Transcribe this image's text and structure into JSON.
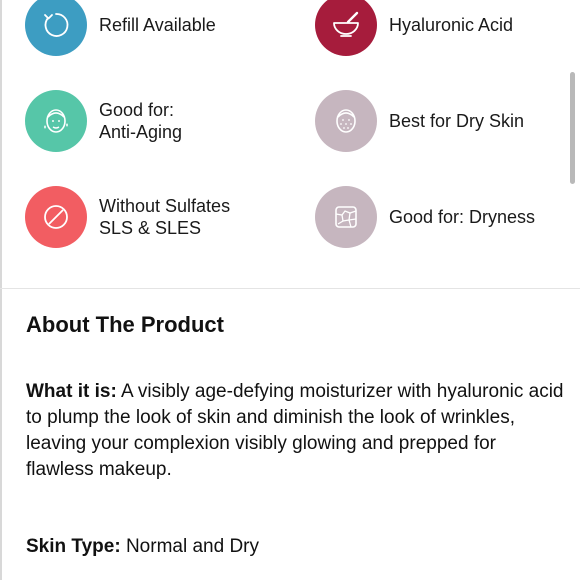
{
  "features": [
    {
      "id": "refill",
      "lines": [
        "Refill Available"
      ],
      "color": "#3d9dc2",
      "icon": "refill-icon"
    },
    {
      "id": "hyaluronic",
      "lines": [
        "Hyaluronic Acid"
      ],
      "color": "#a61c3c",
      "icon": "mortar-pestle-icon"
    },
    {
      "id": "anti-aging",
      "lines": [
        "Good for:",
        "Anti-Aging"
      ],
      "color": "#56c6a8",
      "icon": "face-sparkle-icon"
    },
    {
      "id": "dry-skin",
      "lines": [
        "Best for Dry Skin"
      ],
      "color": "#c6b6bf",
      "icon": "dry-face-icon"
    },
    {
      "id": "sulfates",
      "lines": [
        "Without Sulfates",
        "SLS & SLES"
      ],
      "color": "#f25d62",
      "icon": "no-symbol-icon"
    },
    {
      "id": "dryness",
      "lines": [
        "Good for: Dryness"
      ],
      "color": "#c6b6bf",
      "icon": "cracked-skin-icon"
    }
  ],
  "about": {
    "title": "About The Product",
    "what_label": "What it is:",
    "what_text": " A visibly age-defying moisturizer with hyaluronic acid to plump the look of skin and diminish the look of wrinkles, leaving your complexion visibly glowing and prepped for flawless makeup.",
    "skin_label": "Skin Type:",
    "skin_text": " Normal and Dry"
  }
}
